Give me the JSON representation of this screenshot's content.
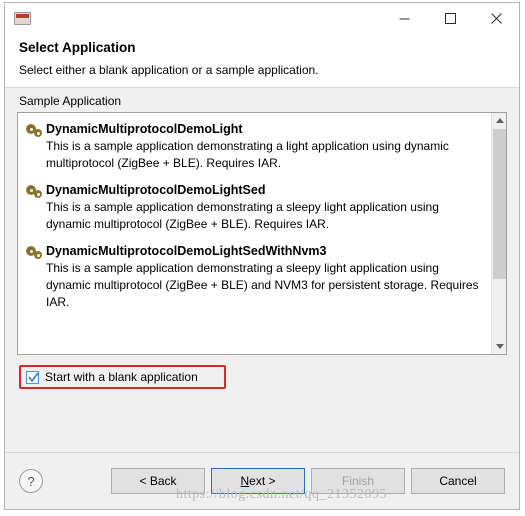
{
  "window": {
    "icon": "application-chip-icon",
    "buttons": {
      "minimize": "minimize-button",
      "maximize": "maximize-button",
      "close": "close-button"
    }
  },
  "header": {
    "title": "Select Application",
    "subtitle": "Select either a blank application or a sample application."
  },
  "group": {
    "label": "Sample Application"
  },
  "samples": [
    {
      "name": "DynamicMultiprotocolDemoLight",
      "description": "This is a sample application demonstrating a light application using dynamic multiprotocol (ZigBee + BLE). Requires IAR."
    },
    {
      "name": "DynamicMultiprotocolDemoLightSed",
      "description": "This is a sample application demonstrating a sleepy light application using dynamic multiprotocol (ZigBee + BLE). Requires IAR."
    },
    {
      "name": "DynamicMultiprotocolDemoLightSedWithNvm3",
      "description": "This is a sample application demonstrating a sleepy light application using dynamic multiprotocol (ZigBee + BLE) and NVM3 for persistent storage. Requires IAR."
    }
  ],
  "blank_checkbox": {
    "label": "Start with a blank application",
    "checked": true,
    "highlight_color": "#d42a2a"
  },
  "footer": {
    "help": "?",
    "back": "< Back",
    "next_prefix": "",
    "next": "Next >",
    "next_mnemonic": "N",
    "finish": "Finish",
    "cancel": "Cancel"
  },
  "watermark": "https://blog.csdn.net/qq_21352095"
}
